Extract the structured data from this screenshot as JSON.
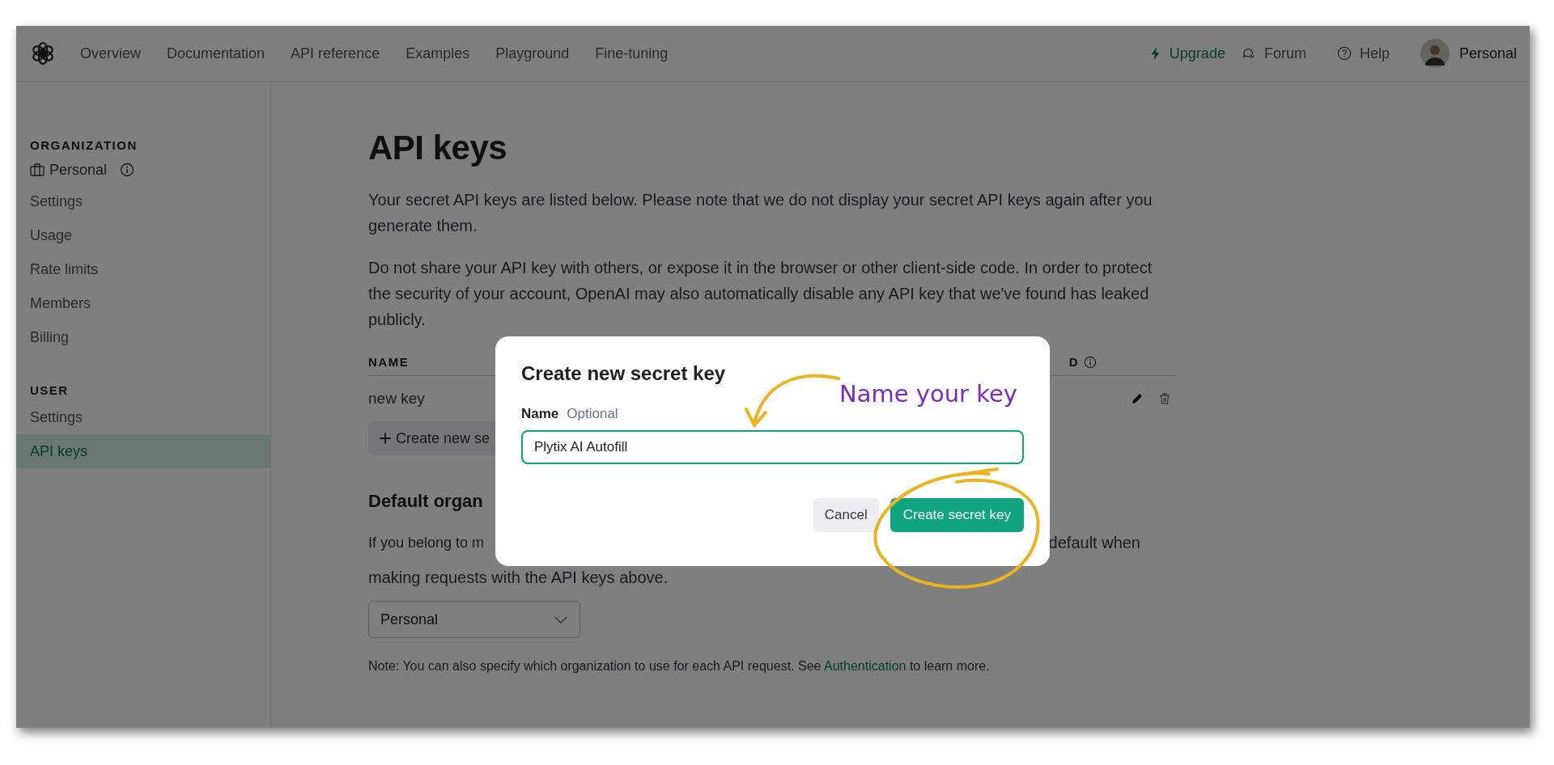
{
  "nav": {
    "links": [
      {
        "label": "Overview"
      },
      {
        "label": "Documentation"
      },
      {
        "label": "API reference"
      },
      {
        "label": "Examples"
      },
      {
        "label": "Playground"
      },
      {
        "label": "Fine-tuning"
      }
    ],
    "upgrade": {
      "label": "Upgrade"
    },
    "forum": {
      "label": "Forum"
    },
    "help": {
      "label": "Help"
    },
    "account": {
      "label": "Personal"
    }
  },
  "sidebar": {
    "sections": [
      {
        "heading": "ORGANIZATION",
        "items": [
          {
            "label": "Personal",
            "kind": "org",
            "selected": false
          },
          {
            "label": "Settings",
            "kind": "link",
            "selected": false
          },
          {
            "label": "Usage",
            "kind": "link",
            "selected": false
          },
          {
            "label": "Rate limits",
            "kind": "link",
            "selected": false
          },
          {
            "label": "Members",
            "kind": "link",
            "selected": false
          },
          {
            "label": "Billing",
            "kind": "link",
            "selected": false
          }
        ]
      },
      {
        "heading": "USER",
        "items": [
          {
            "label": "Settings",
            "kind": "link",
            "selected": false
          },
          {
            "label": "API keys",
            "kind": "link",
            "selected": true
          }
        ]
      }
    ]
  },
  "main": {
    "title": "API keys",
    "paragraphs": [
      "Your secret API keys are listed below. Please note that we do not display your secret API keys again after you generate them.",
      "Do not share your API key with others, or expose it in the browser or other client-side code. In order to protect the security of your account, OpenAI may also automatically disable any API key that we've found has leaked publicly."
    ],
    "table": {
      "columns": [
        "NAME",
        "D"
      ],
      "rows": [
        {
          "name": "new key"
        }
      ]
    },
    "create_button": {
      "label": "Create new se"
    },
    "section_heading": "Default organ",
    "section_text": [
      "If you belong to m",
      "default when",
      "making requests with the API keys above."
    ],
    "select": {
      "value": "Personal"
    },
    "note": {
      "before": "Note: You can also specify which organization to use for each API request. See",
      "link": "Authentication",
      "after": "to learn more."
    }
  },
  "modal": {
    "title": "Create new secret key",
    "field": {
      "label": "Name",
      "hint": "Optional",
      "value": "Plytix AI Autofill"
    },
    "buttons": [
      {
        "label": "Cancel",
        "kind": "secondary"
      },
      {
        "label": "Create secret key",
        "kind": "primary"
      }
    ]
  },
  "annotation": {
    "text": "Name your key"
  }
}
